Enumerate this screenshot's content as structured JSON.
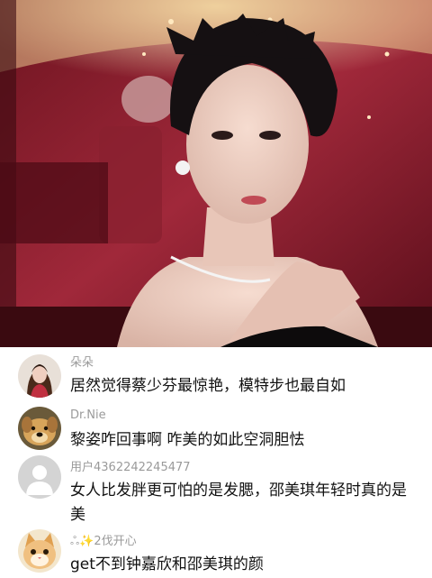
{
  "video": {
    "description_icon": "video-frame"
  },
  "comments": [
    {
      "user": "朵朵",
      "text": "居然觉得蔡少芬最惊艳，模特步也最自如",
      "avatar_icon": "woman-portrait-avatar"
    },
    {
      "user": "Dr.Nie",
      "text": "黎姿咋回事啊 咋美的如此空洞胆怯",
      "avatar_icon": "dog-avatar"
    },
    {
      "user": "用户4362242245477",
      "text": "女人比发胖更可怕的是发腮，邵美琪年轻时真的是美",
      "avatar_icon": "default-user-avatar"
    },
    {
      "user": "ஃ✨2伐开心",
      "text": "get不到钟嘉欣和邵美琪的颜",
      "avatar_icon": "cat-avatar"
    }
  ],
  "colors": {
    "username": "#9a9a9a",
    "text": "#111111",
    "background": "#ffffff"
  }
}
